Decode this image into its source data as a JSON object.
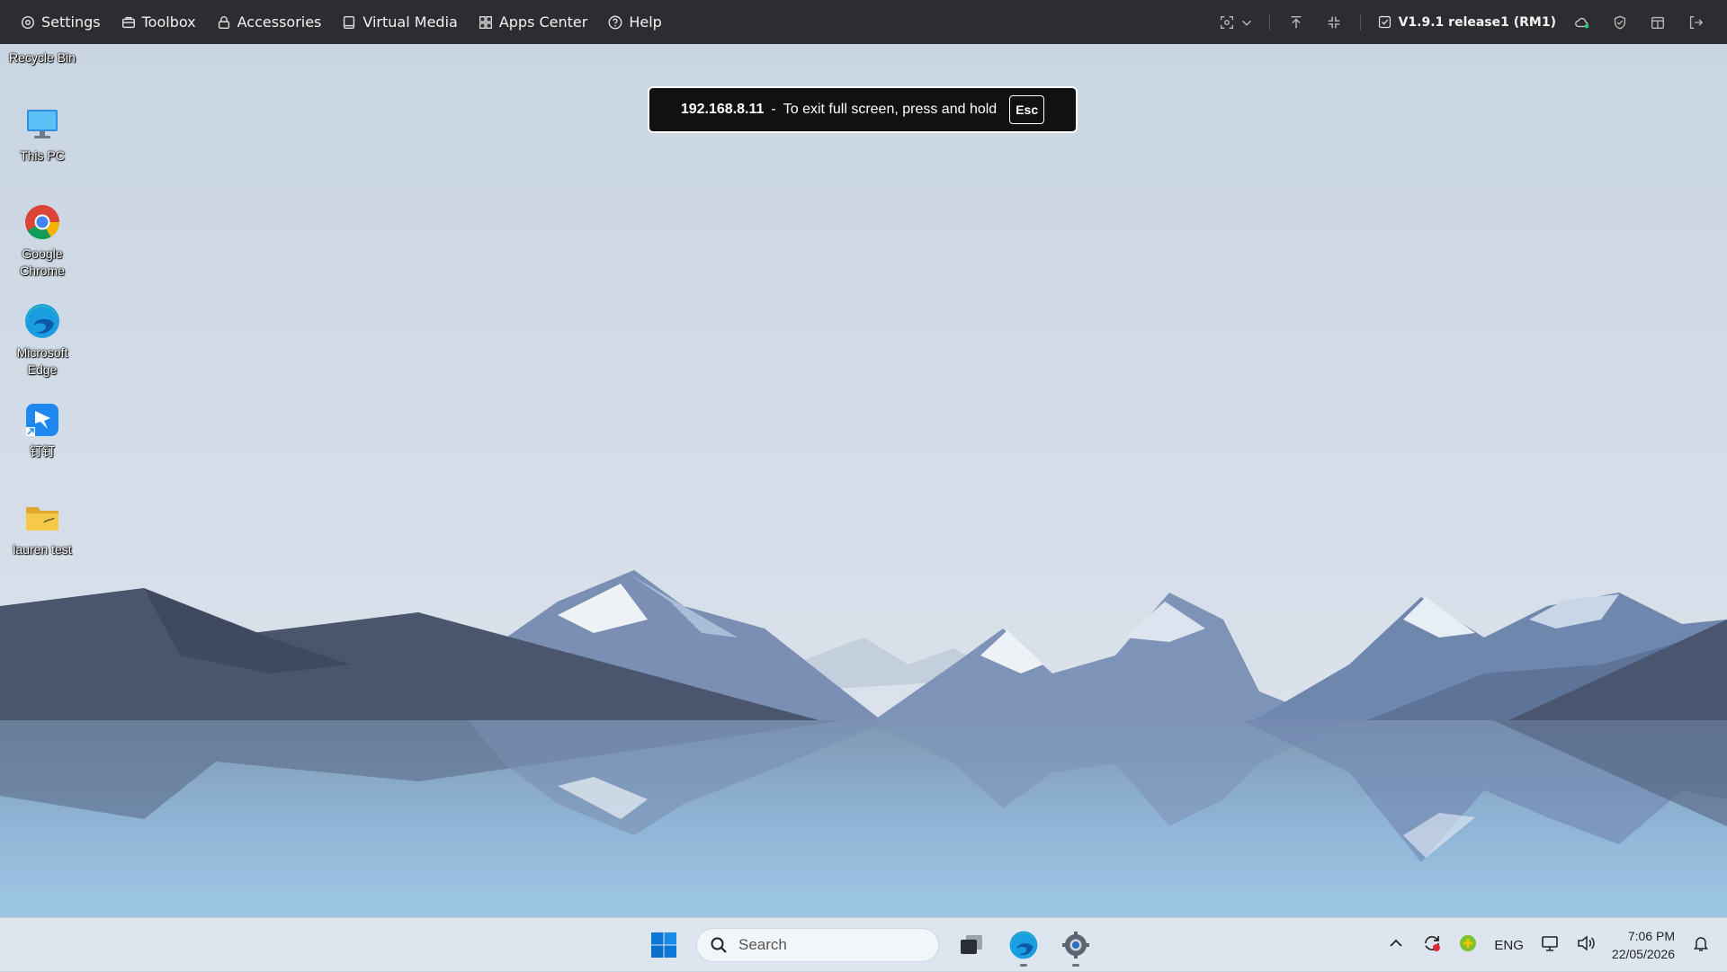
{
  "toolbar": {
    "menu": [
      {
        "label": "Settings",
        "icon": "settings-icon"
      },
      {
        "label": "Toolbox",
        "icon": "toolbox-icon"
      },
      {
        "label": "Accessories",
        "icon": "lock-icon"
      },
      {
        "label": "Virtual Media",
        "icon": "virtual-media-icon"
      },
      {
        "label": "Apps Center",
        "icon": "apps-grid-icon"
      },
      {
        "label": "Help",
        "icon": "help-icon"
      }
    ],
    "version": "V1.9.1 release1 (RM1)",
    "right_icons": [
      "screenshot-icon",
      "chevron-down-icon",
      "pin-top-icon",
      "exit-fullscreen-icon",
      "version-check-icon",
      "cloud-status-icon",
      "shield-icon",
      "window-icon",
      "logout-icon"
    ]
  },
  "fullscreen_notice": {
    "ip": "192.168.8.11",
    "separator": "-",
    "text": "To exit full screen, press and hold",
    "key": "Esc"
  },
  "desktop_icons": [
    {
      "label": "Recycle Bin",
      "icon": "recycle-bin-icon"
    },
    {
      "label": "This PC",
      "icon": "monitor-icon"
    },
    {
      "label": "Google Chrome",
      "icon": "chrome-icon"
    },
    {
      "label": "Microsoft Edge",
      "icon": "edge-icon"
    },
    {
      "label": "钉钉",
      "icon": "dingtalk-icon"
    },
    {
      "label": "lauren test",
      "icon": "folder-icon"
    }
  ],
  "taskbar": {
    "search_placeholder": "Search",
    "language": "ENG",
    "time": "7:06 PM",
    "date": "22/05/2026"
  },
  "colors": {
    "toolbar_bg": "#2b2d30",
    "sky": "#cdd8e4",
    "mountain_dark": "#4a5670",
    "water": "#8fb8dc",
    "taskbar_bg": "#dde6ef",
    "windows_blue": "#0a78d7"
  }
}
